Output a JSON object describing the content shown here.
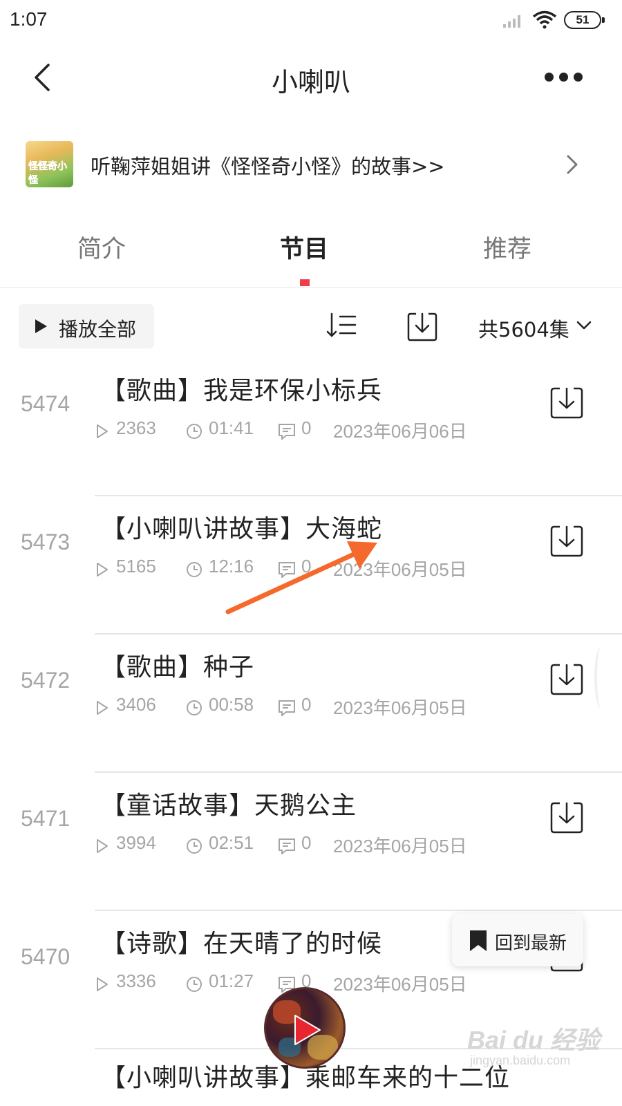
{
  "status_bar": {
    "time": "1:07",
    "battery": "51"
  },
  "nav": {
    "title": "小喇叭"
  },
  "banner": {
    "text": "听鞠萍姐姐讲《怪怪奇小怪》的故事>>",
    "thumb_text": "怪怪奇小怪"
  },
  "tabs": [
    {
      "label": "简介",
      "active": false
    },
    {
      "label": "节目",
      "active": true
    },
    {
      "label": "推荐",
      "active": false
    }
  ],
  "toolbar": {
    "play_all": "播放全部",
    "episode_count": "共5604集"
  },
  "episodes": [
    {
      "number": "5474",
      "title": "【歌曲】我是环保小标兵",
      "plays": "2363",
      "duration": "01:41",
      "comments": "0",
      "date": "2023年06月06日"
    },
    {
      "number": "5473",
      "title": "【小喇叭讲故事】大海蛇",
      "plays": "5165",
      "duration": "12:16",
      "comments": "0",
      "date": "2023年06月05日"
    },
    {
      "number": "5472",
      "title": "【歌曲】种子",
      "plays": "3406",
      "duration": "00:58",
      "comments": "0",
      "date": "2023年06月05日"
    },
    {
      "number": "5471",
      "title": "【童话故事】天鹅公主",
      "plays": "3994",
      "duration": "02:51",
      "comments": "0",
      "date": "2023年06月05日"
    },
    {
      "number": "5470",
      "title": "【诗歌】在天晴了的时候",
      "plays": "3336",
      "duration": "01:27",
      "comments": "0",
      "date": "2023年06月05日"
    },
    {
      "number": "",
      "title": "【小喇叭讲故事】乘邮车来的十二位",
      "plays": "",
      "duration": "",
      "comments": "",
      "date": ""
    }
  ],
  "back_to_latest": "回到最新",
  "watermark": {
    "main": "Bai du 经验",
    "sub": "jingyan.baidu.com"
  },
  "colors": {
    "accent": "#f03d49",
    "annotation_arrow": "#f5692c",
    "muted_text": "#a5a5a5"
  },
  "icons": [
    "back-icon",
    "more-icon",
    "chevron-right-icon",
    "sort-icon",
    "download-icon",
    "chevron-down-icon",
    "play-count-icon",
    "clock-icon",
    "comment-icon",
    "bookmark-icon",
    "play-icon"
  ]
}
